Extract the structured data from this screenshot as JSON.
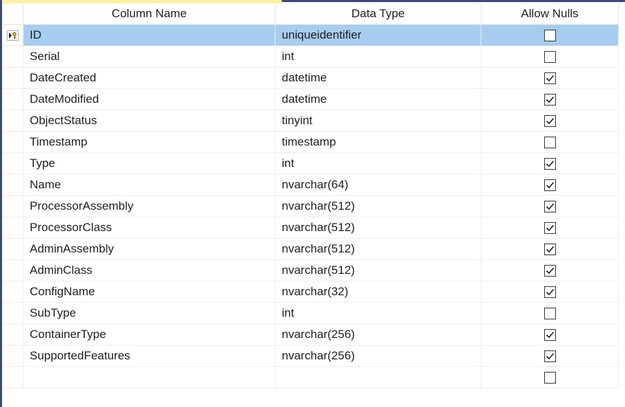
{
  "header": {
    "column_name": "Column Name",
    "data_type": "Data Type",
    "allow_nulls": "Allow Nulls"
  },
  "selected_row_index": 0,
  "rows": [
    {
      "name": "ID",
      "type": "uniqueidentifier",
      "allow_nulls": false,
      "primary_key": true
    },
    {
      "name": "Serial",
      "type": "int",
      "allow_nulls": false
    },
    {
      "name": "DateCreated",
      "type": "datetime",
      "allow_nulls": true
    },
    {
      "name": "DateModified",
      "type": "datetime",
      "allow_nulls": true
    },
    {
      "name": "ObjectStatus",
      "type": "tinyint",
      "allow_nulls": true
    },
    {
      "name": "Timestamp",
      "type": "timestamp",
      "allow_nulls": false
    },
    {
      "name": "Type",
      "type": "int",
      "allow_nulls": true
    },
    {
      "name": "Name",
      "type": "nvarchar(64)",
      "allow_nulls": true
    },
    {
      "name": "ProcessorAssembly",
      "type": "nvarchar(512)",
      "allow_nulls": true
    },
    {
      "name": "ProcessorClass",
      "type": "nvarchar(512)",
      "allow_nulls": true
    },
    {
      "name": "AdminAssembly",
      "type": "nvarchar(512)",
      "allow_nulls": true
    },
    {
      "name": "AdminClass",
      "type": "nvarchar(512)",
      "allow_nulls": true
    },
    {
      "name": "ConfigName",
      "type": "nvarchar(32)",
      "allow_nulls": true
    },
    {
      "name": "SubType",
      "type": "int",
      "allow_nulls": false
    },
    {
      "name": "ContainerType",
      "type": "nvarchar(256)",
      "allow_nulls": true
    },
    {
      "name": "SupportedFeatures",
      "type": "nvarchar(256)",
      "allow_nulls": true
    },
    {
      "name": "",
      "type": "",
      "allow_nulls": false
    }
  ],
  "icons": {
    "row_selector": "current-row-primary-key-icon",
    "check": "checkmark-icon"
  },
  "colors": {
    "selection": "#a6cdf0",
    "grid_line": "#ececec"
  }
}
